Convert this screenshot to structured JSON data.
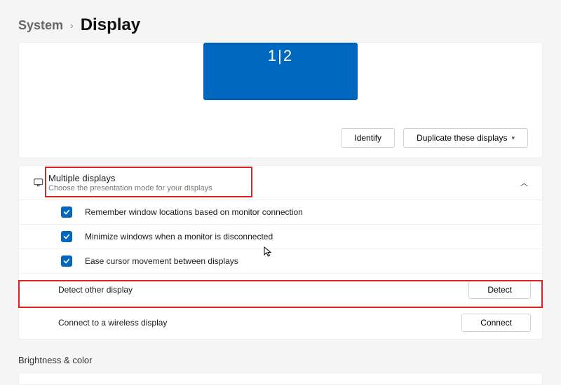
{
  "breadcrumb": {
    "system": "System",
    "current": "Display"
  },
  "monitor": {
    "label": "1|2"
  },
  "buttons": {
    "identify": "Identify",
    "projection": "Duplicate these displays"
  },
  "expander": {
    "title": "Multiple displays",
    "subtitle": "Choose the presentation mode for your displays"
  },
  "options": {
    "remember": "Remember window locations based on monitor connection",
    "minimize": "Minimize windows when a monitor is disconnected",
    "ease": "Ease cursor movement between displays",
    "detect_label": "Detect other display",
    "detect_btn": "Detect",
    "wireless_label": "Connect to a wireless display",
    "wireless_btn": "Connect"
  },
  "next_section": "Brightness & color"
}
